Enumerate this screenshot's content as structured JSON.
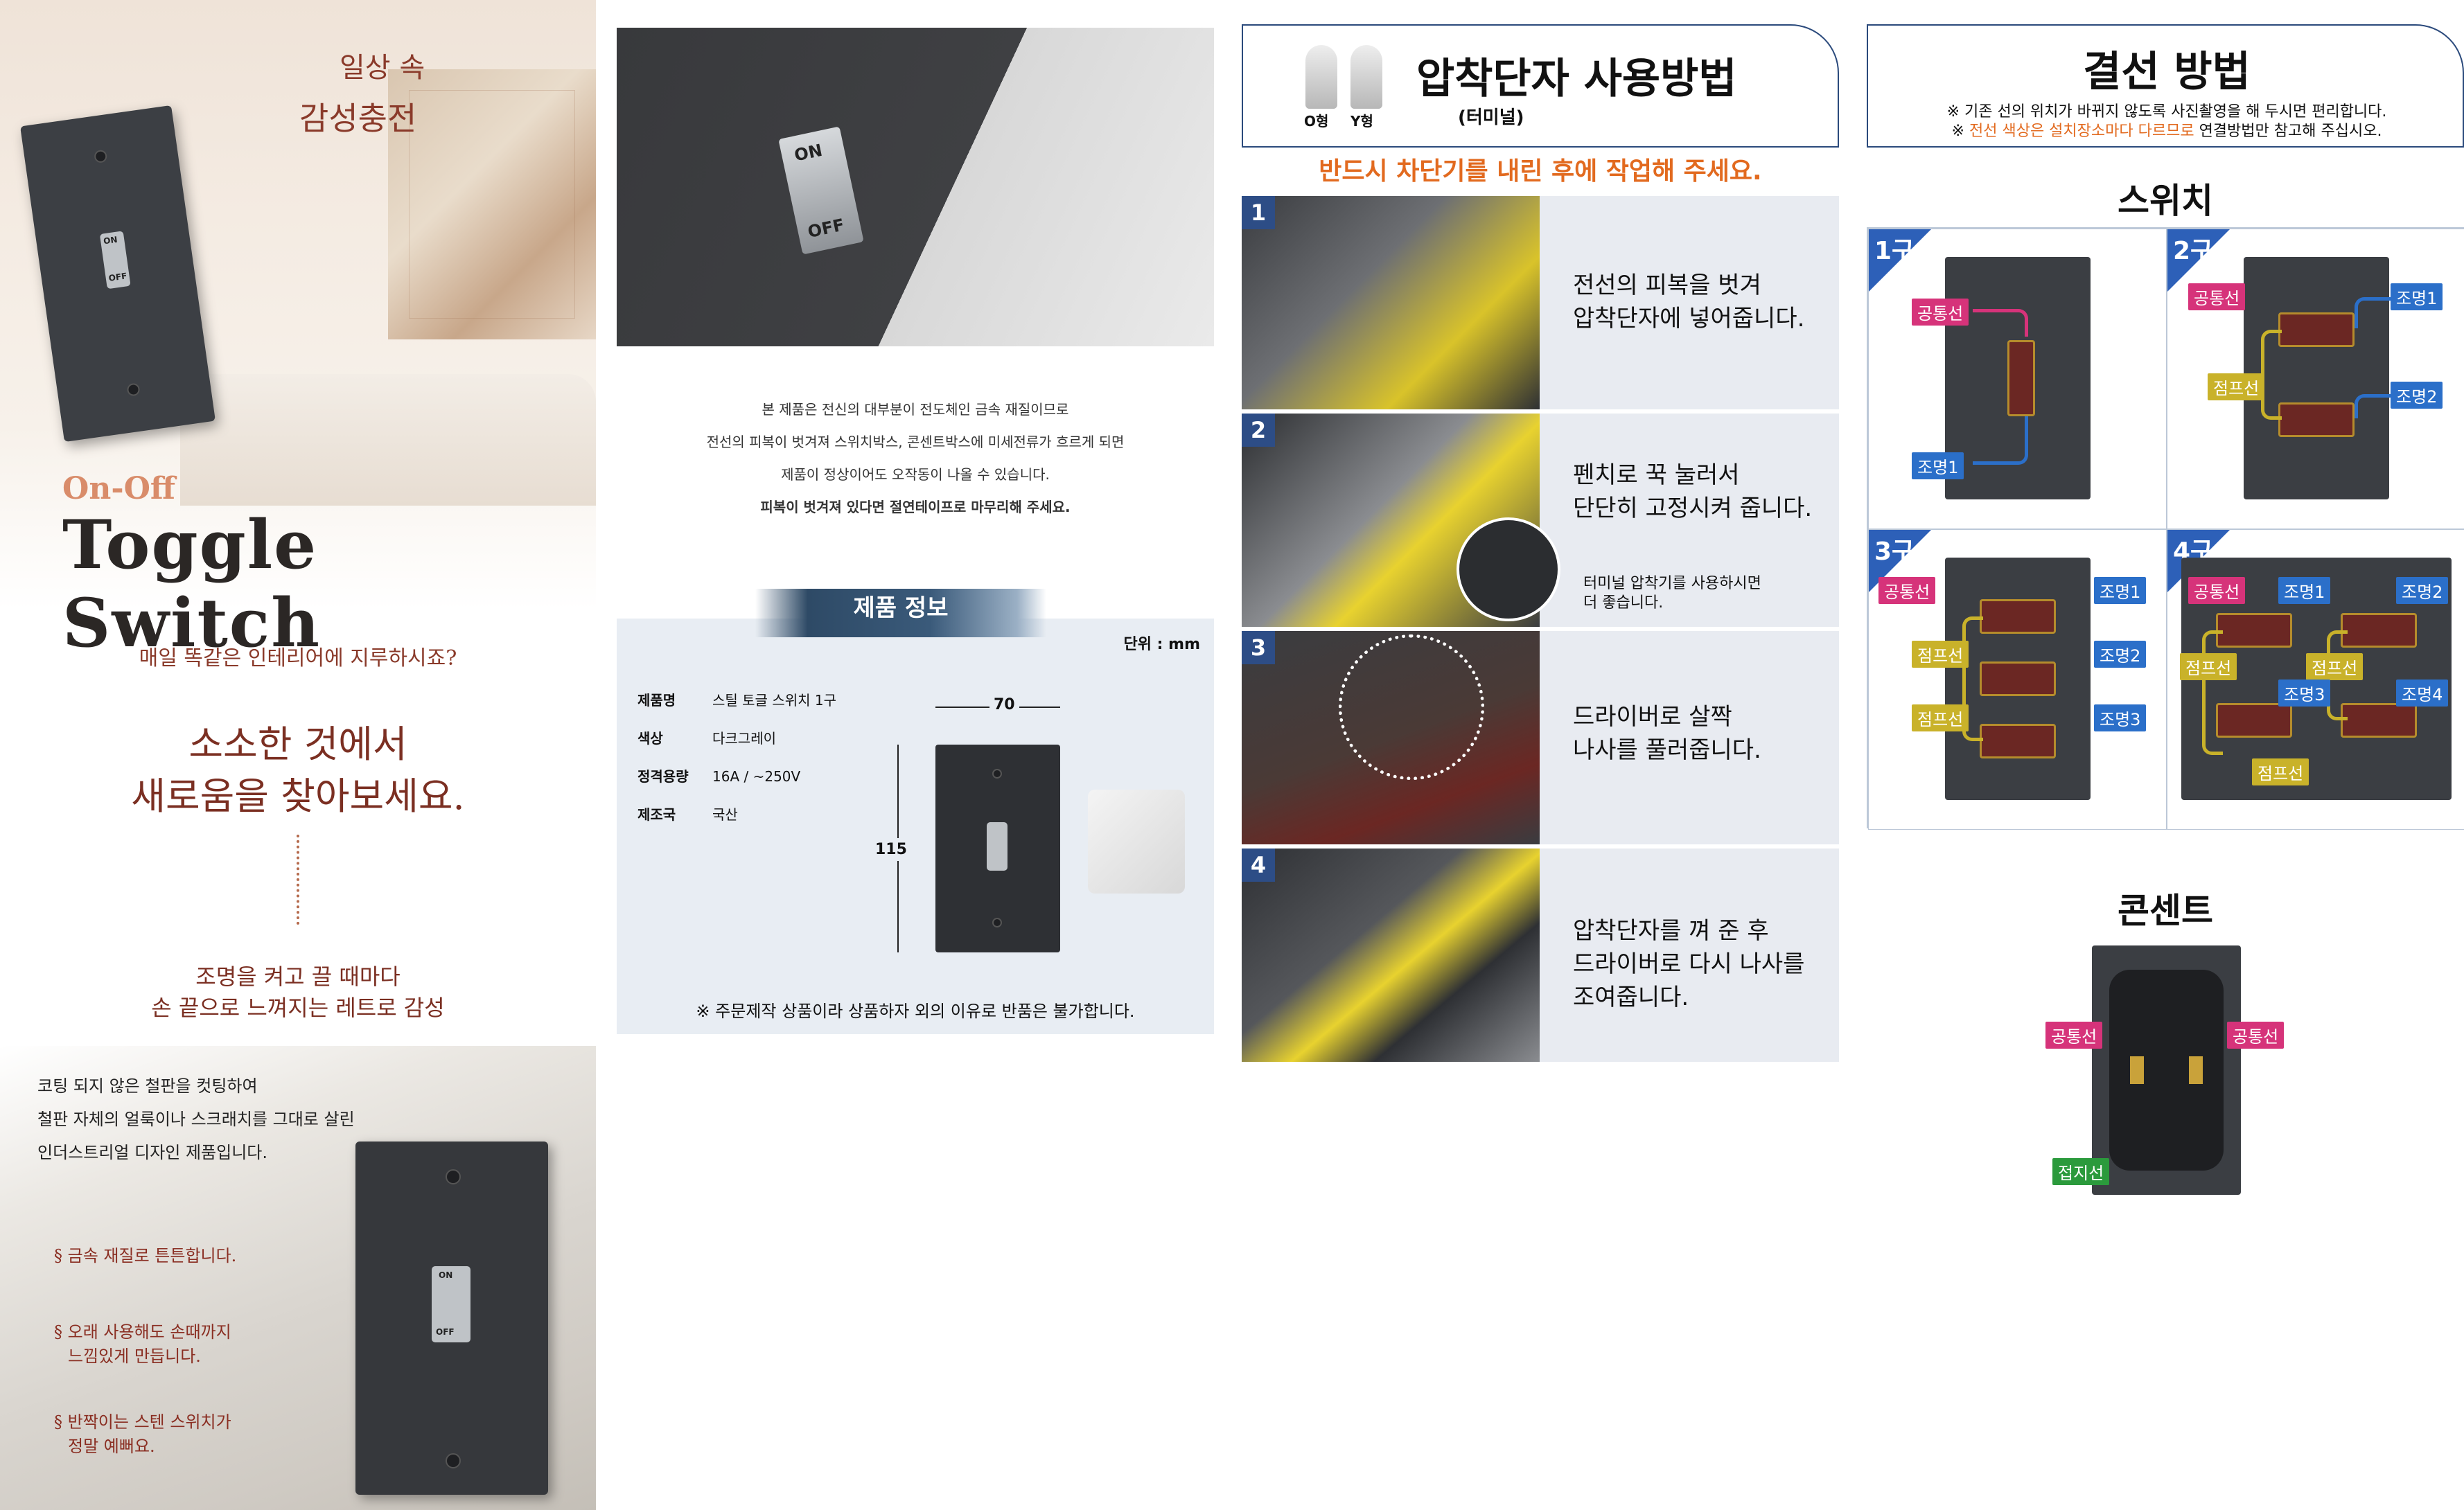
{
  "col1": {
    "tagline_line1": "일상 속",
    "tagline_line2": "감성충전",
    "switch_on": "ON",
    "switch_off": "OFF",
    "subtitle": "On-Off",
    "title": "Toggle Switch",
    "question": "매일 똑같은 인테리어에 지루하시죠?",
    "headline_line1": "소소한 것에서",
    "headline_line2": "새로움을 찾아보세요.",
    "retro_line1": "조명을 켜고 끌 때마다",
    "retro_line2": "손 끝으로 느껴지는 레트로 감성",
    "desc": [
      "코팅 되지 않은 철판을 컷팅하여",
      "철판 자체의 얼룩이나 스크래치를 그대로 살린",
      "인더스트리얼 디자인 제품입니다."
    ],
    "features": [
      {
        "l1": "§ 금속 재질로 튼튼합니다.",
        "l2": ""
      },
      {
        "l1": "§ 오래 사용해도 손때까지",
        "l2": "느낌있게 만듭니다."
      },
      {
        "l1": "§ 반짝이는 스텐 스위치가",
        "l2": "정말 예뻐요."
      }
    ]
  },
  "col2": {
    "notice": [
      "본 제품은 전신의 대부분이 전도체인 금속 재질이므로",
      "전선의 피복이 벗겨져 스위치박스, 콘센트박스에 미세전류가 흐르게 되면",
      "제품이 정상이어도 오작동이 나올 수 있습니다.",
      "피복이 벗겨져 있다면 절연테이프로 마무리해 주세요."
    ],
    "section_title": "제품 정보",
    "unit": "단위 : mm",
    "specs": [
      {
        "k": "제품명",
        "v": "스틸 토글 스위치 1구"
      },
      {
        "k": "색상",
        "v": "다크그레이"
      },
      {
        "k": "정격용량",
        "v": "16A / ~250V"
      },
      {
        "k": "제조국",
        "v": "국산"
      }
    ],
    "width": "70",
    "height": "115",
    "footnote": "※ 주문제작 상품이라 상품하자 외의 이유로 반품은 불가합니다."
  },
  "col3": {
    "terminal_o": "O형",
    "terminal_y": "Y형",
    "title": "압착단자 사용방법",
    "subtitle": "(터미널)",
    "warning": "반드시 차단기를 내린 후에 작업해 주세요.",
    "steps": [
      {
        "n": "1",
        "l1": "전선의 피복을 벗겨",
        "l2": "압착단자에 넣어줍니다.",
        "l3": "",
        "note1": "",
        "note2": ""
      },
      {
        "n": "2",
        "l1": "펜치로 꾹 눌러서",
        "l2": "단단히 고정시켜 줍니다.",
        "l3": "",
        "note1": "터미널 압착기를 사용하시면",
        "note2": "더 좋습니다."
      },
      {
        "n": "3",
        "l1": "드라이버로 살짝",
        "l2": "나사를 풀러줍니다.",
        "l3": "",
        "note1": "",
        "note2": ""
      },
      {
        "n": "4",
        "l1": "압착단자를 껴 준 후",
        "l2": "드라이버로 다시 나사를",
        "l3": "조여줍니다.",
        "note1": "",
        "note2": ""
      }
    ]
  },
  "col4": {
    "title": "결선 방법",
    "note1": "※ 기존 선의 위치가 바뀌지 않도록 사진촬영을 해 두시면 편리합니다.",
    "note2_pre": "※ ",
    "note2_orange": "전선 색상은 설치장소마다 다르므로",
    "note2_post": " 연결방법만 참고해 주십시오.",
    "switch_title": "스위치",
    "outlet_title": "콘센트",
    "gang": [
      "1구",
      "2구",
      "3구",
      "4구"
    ],
    "common": "공통선",
    "jumper": "점프선",
    "light1": "조명1",
    "light2": "조명2",
    "light3": "조명3",
    "light4": "조명4",
    "ground": "접지선",
    "colors": {
      "common": "#d6337a",
      "light": "#2b6fc9",
      "jumper": "#c9b22a",
      "ground": "#2b9a3c"
    }
  }
}
